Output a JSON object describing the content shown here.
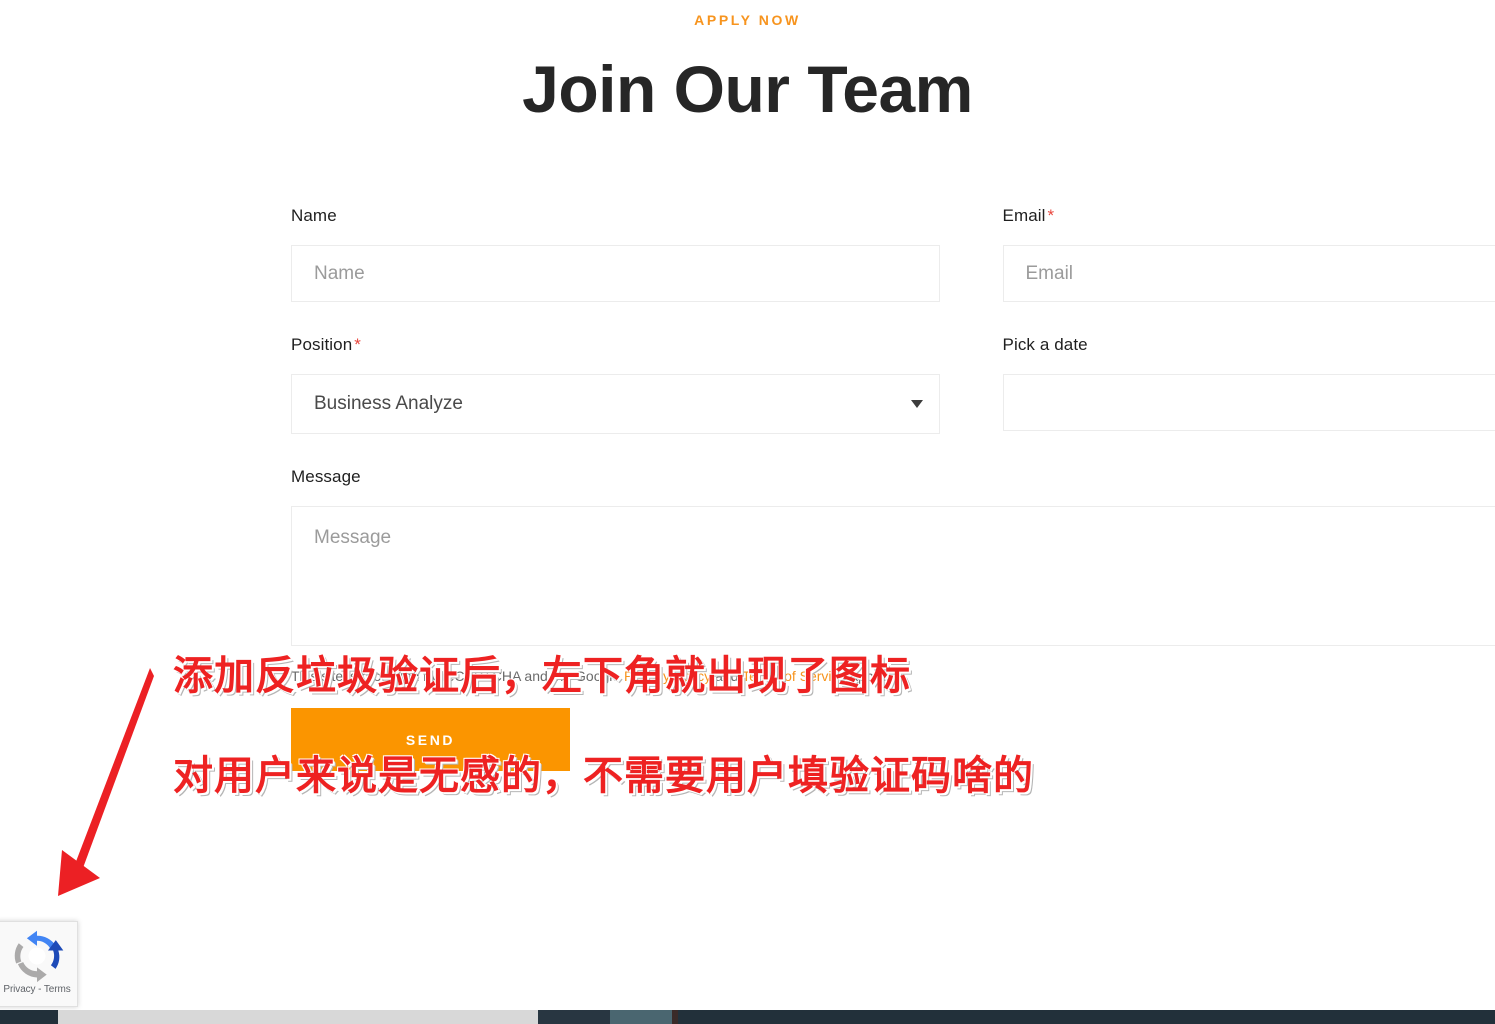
{
  "header": {
    "eyebrow": "APPLY NOW",
    "title": "Join Our Team"
  },
  "form": {
    "name": {
      "label": "Name",
      "required": false,
      "placeholder": "Name",
      "value": ""
    },
    "email": {
      "label": "Email",
      "required": true,
      "required_marker": "*",
      "placeholder": "Email",
      "value": ""
    },
    "position": {
      "label": "Position",
      "required": true,
      "required_marker": "*",
      "selected": "Business Analyze",
      "caret_icon": "chevron-down-icon"
    },
    "date": {
      "label": "Pick a date",
      "required": false,
      "placeholder": "",
      "value": ""
    },
    "message": {
      "label": "Message",
      "placeholder": "Message",
      "value": ""
    },
    "legal": {
      "prefix": "This site is protected by reCAPTCHA and the Google ",
      "privacy_link": "Privacy Policy",
      "middle": " and ",
      "terms_link": "Terms of Service",
      "suffix": " apply."
    },
    "submit": {
      "label": "SEND"
    }
  },
  "recaptcha_badge": {
    "logo_icon": "recaptcha-logo-icon",
    "privacy_label": "Privacy",
    "separator": " - ",
    "terms_label": "Terms",
    "links_text": "Privacy - Terms"
  },
  "annotation": {
    "line1": "添加反垃圾验证后，左下角就出现了图标",
    "line2": "对用户来说是无感的，不需要用户填验证码啥的",
    "arrow_icon": "red-arrow-icon"
  },
  "colors": {
    "accent_orange": "#f7941e",
    "button_orange": "#fb9500",
    "required_red": "#e8453c",
    "annotation_red": "#ee2222",
    "title_dark": "#262626",
    "border_gray": "#ececec",
    "placeholder_gray": "#9b9b9b",
    "taskbar_dark": "#22303a"
  }
}
